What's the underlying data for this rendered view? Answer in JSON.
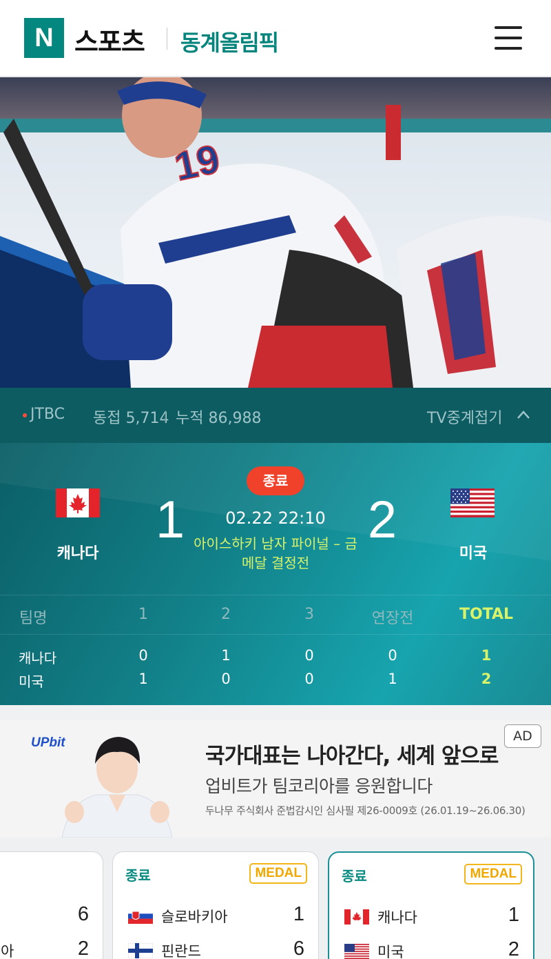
{
  "header": {
    "logo_letter": "N",
    "brand": "스포츠",
    "section": "동계올림픽"
  },
  "icons": {
    "menu": "hamburger-menu-icon",
    "fold": "chevron-up-icon"
  },
  "broadcast": {
    "channel": "JTBC",
    "concurrent": "동접 5,714",
    "cumulative": "누적 86,988",
    "fold_label": "TV중계접기"
  },
  "match": {
    "status": "종료",
    "datetime": "02.22 22:10",
    "game_name": "아이스하키 남자 파이널 – 금메달 결정전",
    "home": {
      "name": "캐나다",
      "score": "1"
    },
    "away": {
      "name": "미국",
      "score": "2"
    }
  },
  "scoreboard": {
    "headers": [
      "팀명",
      "1",
      "2",
      "3",
      "연장전",
      "TOTAL"
    ],
    "rows": [
      {
        "team": "캐나다",
        "p1": "0",
        "p2": "1",
        "p3": "0",
        "ot": "0",
        "total": "1"
      },
      {
        "team": "미국",
        "p1": "1",
        "p2": "0",
        "p3": "0",
        "ot": "1",
        "total": "2"
      }
    ]
  },
  "ad": {
    "brand": "UPbit",
    "headline": "국가대표는 나아간다, 세계 앞으로",
    "subline": "업비트가 팀코리아를 응원합니다",
    "fine_print": "두나무 주식회사 준법감시인 심사필 제26-0009호 (26.01.19~26.06.30)",
    "badge": "AD"
  },
  "cards": [
    {
      "rows": [
        {
          "team": "",
          "score": "6"
        },
        {
          "team": "아",
          "score": "2"
        }
      ]
    },
    {
      "status": "종료",
      "badge": "MEDAL",
      "rows": [
        {
          "team": "슬로바키아",
          "score": "1"
        },
        {
          "team": "핀란드",
          "score": "6"
        }
      ]
    },
    {
      "status": "종료",
      "badge": "MEDAL",
      "rows": [
        {
          "team": "캐나다",
          "score": "1"
        },
        {
          "team": "미국",
          "score": "2"
        }
      ]
    }
  ],
  "colors": {
    "brand_green": "#04877f",
    "status_red": "#f0412b",
    "highlight_yellow": "#d8f36a",
    "medal_gold": "#f2b51a"
  }
}
